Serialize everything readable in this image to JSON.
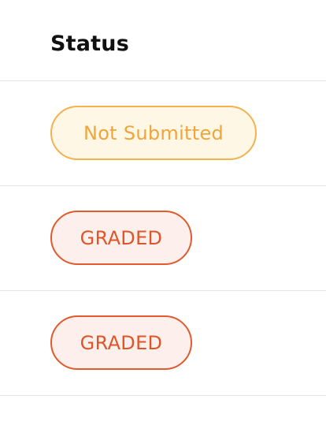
{
  "table": {
    "header": {
      "status": "Status"
    },
    "rows": [
      {
        "status": "Not Submitted",
        "type": "not-submitted"
      },
      {
        "status": "GRADED",
        "type": "graded"
      },
      {
        "status": "GRADED",
        "type": "graded"
      }
    ]
  },
  "colors": {
    "not_submitted_bg": "#fff7e6",
    "not_submitted_border": "#f2b24e",
    "not_submitted_text": "#efa53a",
    "graded_bg": "#fdefec",
    "graded_border": "#e05a2e",
    "graded_text": "#de5527"
  }
}
